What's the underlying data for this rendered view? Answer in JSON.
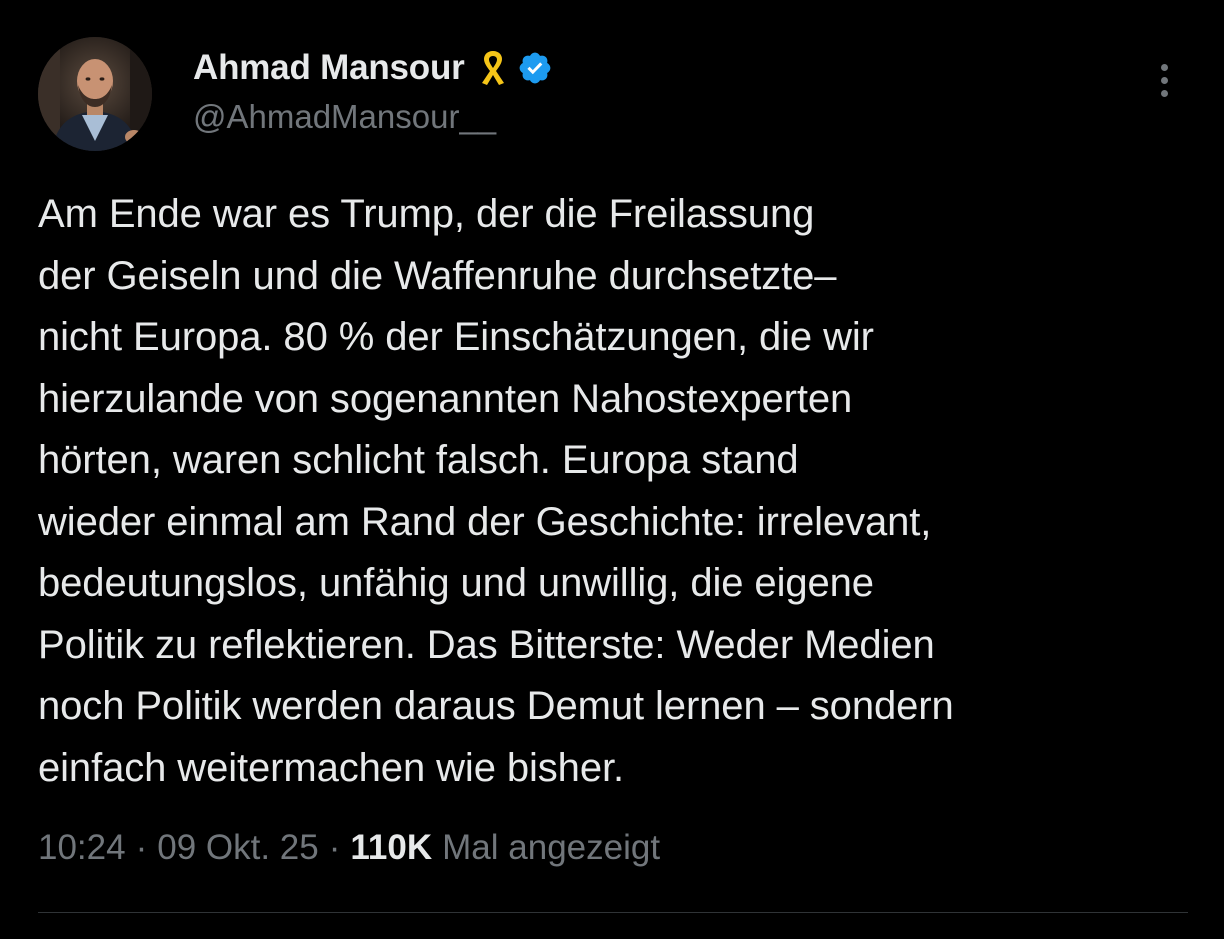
{
  "author": {
    "display_name": "Ahmad Mansour",
    "handle": "@AhmadMansour__",
    "badges": [
      "yellow-ribbon-icon",
      "verified-badge-icon"
    ]
  },
  "post": {
    "lines": [
      "Am Ende war es Trump, der die Freilassung",
      "der Geiseln und die Waffenruhe durchsetzte–",
      "nicht Europa. 80 % der Einschätzungen, die wir",
      "hierzulande von sogenannten Nahostexperten",
      "hörten, waren schlicht falsch. Europa stand",
      "wieder einmal am Rand der Geschichte: irrelevant,",
      "bedeutungslos, unfähig und unwillig, die eigene",
      "Politik zu reflektieren. Das Bitterste: Weder Medien",
      "noch Politik werden daraus Demut lernen – sondern",
      "einfach weitermachen wie bisher."
    ]
  },
  "meta": {
    "time": "10:24",
    "separator": "·",
    "date": "09 Okt. 25",
    "views_count": "110K",
    "views_label": "Mal angezeigt"
  },
  "colors": {
    "background": "#000000",
    "primary_text": "#e7e9ea",
    "secondary_text": "#71767b",
    "verified_blue": "#1d9bf0",
    "ribbon_yellow": "#f5c518",
    "divider": "#2f3336"
  },
  "icons": {
    "more": "more-vertical-icon"
  }
}
